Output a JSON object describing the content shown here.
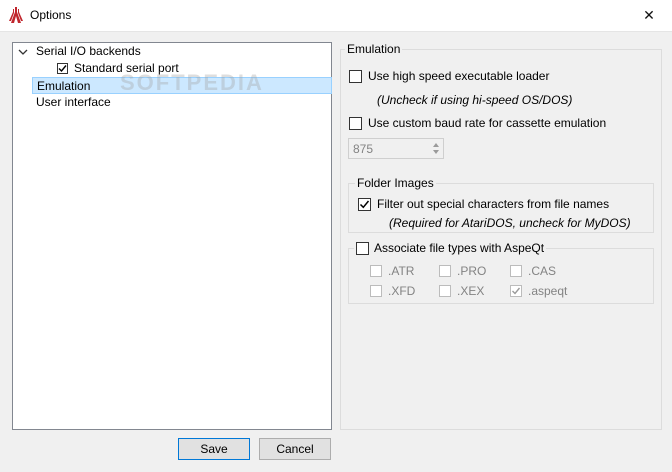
{
  "window": {
    "title": "Options",
    "close_glyph": "✕"
  },
  "tree": {
    "items": [
      {
        "label": "Serial I/O backends",
        "expanded": true
      },
      {
        "label": "Standard serial port",
        "checked": true
      },
      {
        "label": "Emulation",
        "selected": true
      },
      {
        "label": "User interface"
      }
    ]
  },
  "emulation": {
    "group_title": "Emulation",
    "high_speed": {
      "label": "Use high speed executable loader",
      "checked": false,
      "hint": "(Uncheck if using hi-speed OS/DOS)"
    },
    "custom_baud": {
      "label": "Use custom baud rate for cassette emulation",
      "checked": false
    },
    "baud_value": "875",
    "folder_images": {
      "title": "Folder Images",
      "filter_label": "Filter out special characters from file names",
      "filter_checked": true,
      "filter_hint": "(Required for AtariDOS, uncheck for MyDOS)"
    },
    "associate": {
      "label": "Associate file types with AspeQt",
      "checked": false,
      "types": [
        {
          "label": ".ATR",
          "checked": false
        },
        {
          "label": ".PRO",
          "checked": false
        },
        {
          "label": ".CAS",
          "checked": false
        },
        {
          "label": ".XFD",
          "checked": false
        },
        {
          "label": ".XEX",
          "checked": false
        },
        {
          "label": ".aspeqt",
          "checked": true
        }
      ]
    }
  },
  "buttons": {
    "save": "Save",
    "cancel": "Cancel"
  },
  "watermark": "SOFTPEDIA",
  "colors": {
    "selection_bg": "#cce8ff",
    "default_border": "#0078d7",
    "app_icon": "#c0262d"
  }
}
